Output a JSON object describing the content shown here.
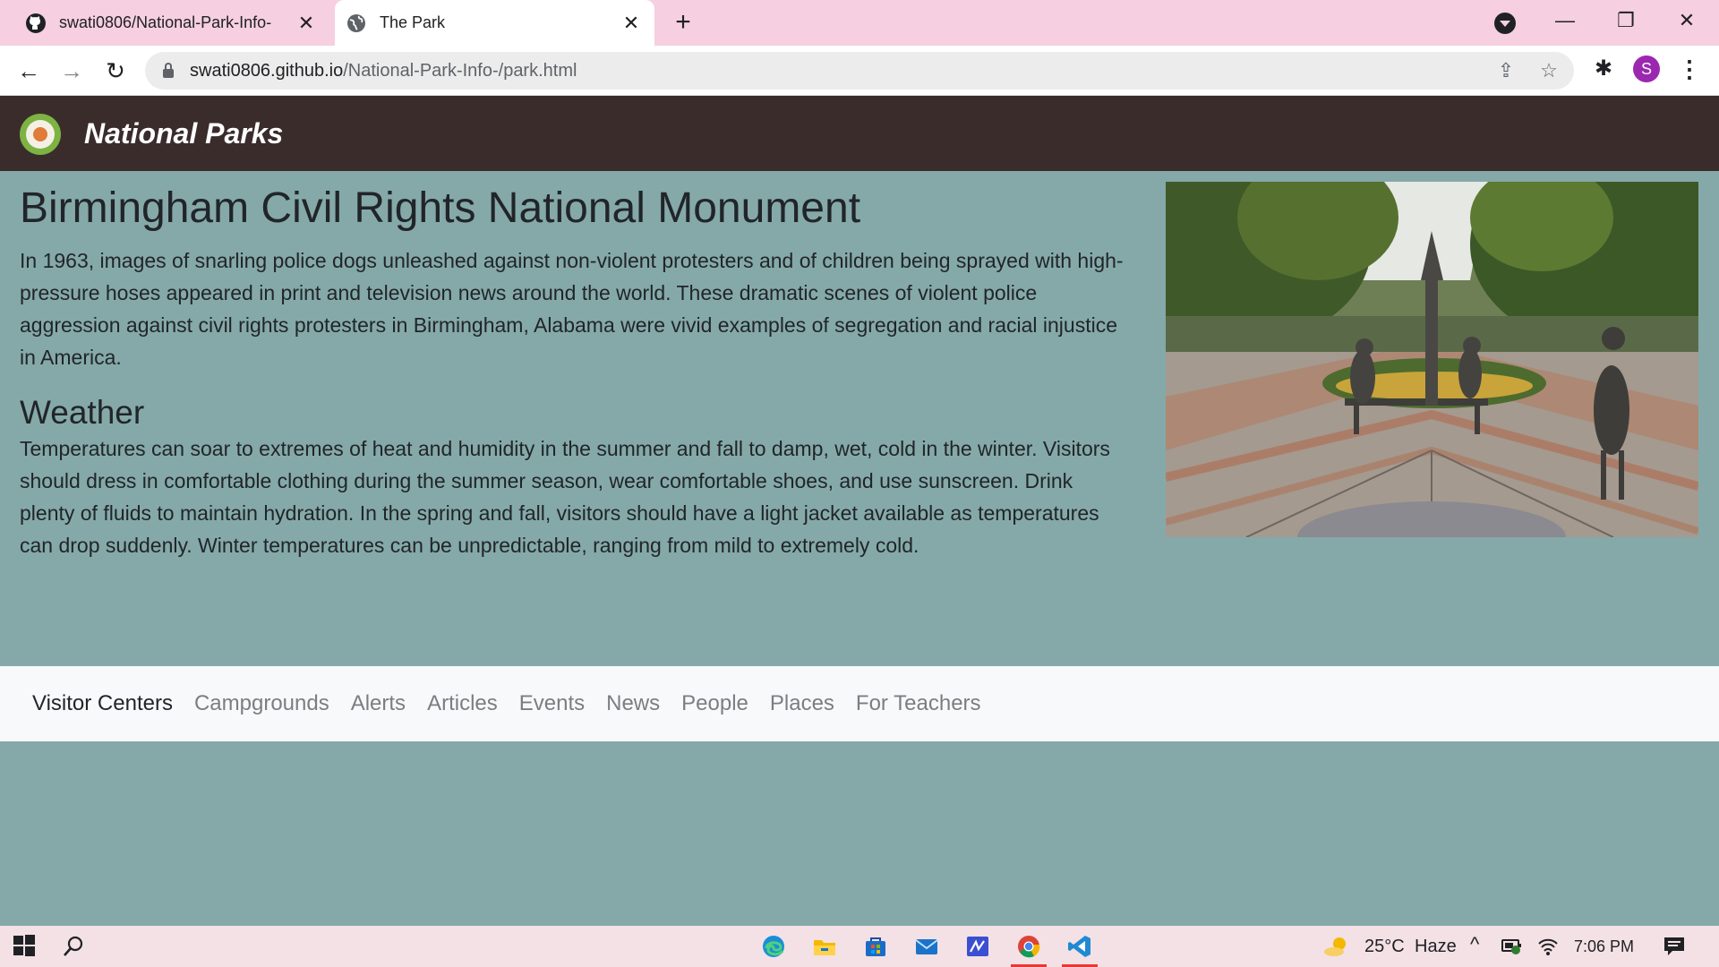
{
  "browser": {
    "tabs": [
      {
        "title": "swati0806/National-Park-Info-",
        "favicon": "github-icon",
        "active": false
      },
      {
        "title": "The Park",
        "favicon": "globe-icon",
        "active": true
      }
    ],
    "url_host": "swati0806.github.io",
    "url_path": "/National-Park-Info-/park.html",
    "profile_initial": "S",
    "tabstrip_color": "#f6cfe0"
  },
  "site": {
    "brand": "National Parks",
    "nav_color": "#3a2c2b",
    "background_color": "#85a9a9"
  },
  "park": {
    "title": "Birmingham Civil Rights National Monument",
    "description": "In 1963, images of snarling police dogs unleashed against non-violent protesters and of children being sprayed with high-pressure hoses appeared in print and television news around the world. These dramatic scenes of violent police aggression against civil rights protesters in Birmingham, Alabama were vivid examples of segregation and racial injustice in America.",
    "weather_heading": "Weather",
    "weather_text": "Temperatures can soar to extremes of heat and humidity in the summer and fall to damp, wet, cold in the winter. Visitors should dress in comfortable clothing during the summer season, wear comfortable shoes, and use sunscreen. Drink plenty of fluids to maintain hydration. In the spring and fall, visitors should have a light jacket available as temperatures can drop suddenly. Winter temperatures can be unpredictable, ranging from mild to extremely cold."
  },
  "footer_nav": [
    {
      "label": "Visitor Centers",
      "active": true
    },
    {
      "label": "Campgrounds"
    },
    {
      "label": "Alerts"
    },
    {
      "label": "Articles"
    },
    {
      "label": "Events"
    },
    {
      "label": "News"
    },
    {
      "label": "People"
    },
    {
      "label": "Places"
    },
    {
      "label": "For Teachers"
    }
  ],
  "taskbar": {
    "temperature": "25°C",
    "weather": "Haze",
    "time": "7:06 PM"
  }
}
